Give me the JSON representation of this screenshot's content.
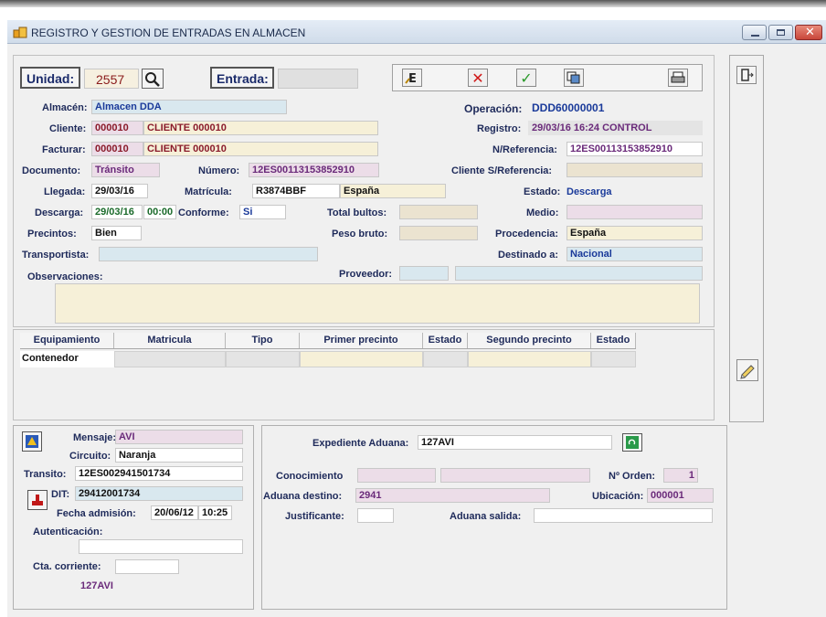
{
  "window": {
    "title": "REGISTRO Y GESTION DE ENTRADAS EN ALMACEN",
    "controls": [
      "minimize",
      "maximize",
      "close"
    ]
  },
  "header": {
    "unidad_label": "Unidad:",
    "unidad_value": "2557",
    "entrada_label": "Entrada:",
    "entrada_value": ""
  },
  "form": {
    "almacen_label": "Almacén:",
    "almacen_value": "Almacen DDA",
    "operacion_label": "Operación:",
    "operacion_value": "DDD60000001",
    "cliente_label": "Cliente:",
    "cliente_code": "000010",
    "cliente_name": "CLIENTE 000010",
    "registro_label": "Registro:",
    "registro_value": "29/03/16  16:24  CONTROL",
    "facturar_label": "Facturar:",
    "facturar_code": "000010",
    "facturar_name": "CLIENTE 000010",
    "nref_label": "N/Referencia:",
    "nref_value": "12ES00113153852910",
    "documento_label": "Documento:",
    "documento_value": "Tránsito",
    "numero_label": "Número:",
    "numero_value": "12ES00113153852910",
    "sref_label": "Cliente S/Referencia:",
    "sref_value": "",
    "llegada_label": "Llegada:",
    "llegada_value": "29/03/16",
    "matricula_label": "Matrícula:",
    "matricula_value": "R3874BBF",
    "pais_value": "España",
    "estado_label": "Estado:",
    "estado_value": "Descarga",
    "descarga_label": "Descarga:",
    "descarga_date": "29/03/16",
    "descarga_time": "00:00",
    "conforme_label": "Conforme:",
    "conforme_value": "Si",
    "total_bultos_label": "Total bultos:",
    "total_bultos_value": "",
    "medio_label": "Medio:",
    "medio_value": "",
    "precintos_label": "Precintos:",
    "precintos_value": "Bien",
    "peso_bruto_label": "Peso bruto:",
    "peso_bruto_value": "",
    "procedencia_label": "Procedencia:",
    "procedencia_value": "España",
    "transportista_label": "Transportista:",
    "transportista_value": "",
    "destinado_label": "Destinado a:",
    "destinado_value": "Nacional",
    "observaciones_label": "Observaciones:",
    "observaciones_value": "",
    "proveedor_label": "Proveedor:",
    "proveedor_code": "",
    "proveedor_name": ""
  },
  "table": {
    "headers": [
      "Equipamiento",
      "Matricula",
      "Tipo",
      "Primer precinto",
      "Estado",
      "Segundo precinto",
      "Estado"
    ],
    "rows": [
      [
        "Contenedor",
        "",
        "",
        "",
        "",
        "",
        ""
      ]
    ]
  },
  "bottom_left": {
    "mensaje_label": "Mensaje:",
    "mensaje_value": "AVI",
    "circuito_label": "Circuito:",
    "circuito_value": "Naranja",
    "transito_label": "Transito:",
    "transito_value": "12ES002941501734",
    "dit_label": "DIT:",
    "dit_value": "29412001734",
    "fecha_label": "Fecha admisión:",
    "fecha_date": "20/06/12",
    "fecha_time": "10:25",
    "autenticacion_label": "Autenticación:",
    "autenticacion_value": "",
    "cta_label": "Cta. corriente:",
    "cta_value": "",
    "footer_code": "127AVI"
  },
  "bottom_right": {
    "expediente_label": "Expediente Aduana:",
    "expediente_value": "127AVI",
    "conocimiento_label": "Conocimiento",
    "conocimiento_a": "",
    "conocimiento_b": "",
    "orden_label": "Nº Orden:",
    "orden_value": "1",
    "aduana_destino_label": "Aduana destino:",
    "aduana_destino_value": "2941",
    "ubicacion_label": "Ubicación:",
    "ubicacion_value": "000001",
    "justificante_label": "Justificante:",
    "justificante_value": "",
    "aduana_salida_label": "Aduana salida:",
    "aduana_salida_value": ""
  },
  "icons": {
    "app": "warehouse-icon",
    "search": "search-icon",
    "edit": "edit-icon",
    "delete": "x-icon",
    "confirm": "check-icon",
    "copy": "copy-icon",
    "print": "printer-icon",
    "exit": "exit-door-icon",
    "note": "pencil-note-icon",
    "message": "message-icon",
    "dit": "stamp-icon",
    "refresh": "refresh-icon"
  },
  "colors": {
    "title_bar": "#dce6f2",
    "field_pink": "#ecdde8",
    "field_cream": "#f6f0d8",
    "field_blue": "#d9e8ef",
    "close_red": "#c8463a"
  }
}
